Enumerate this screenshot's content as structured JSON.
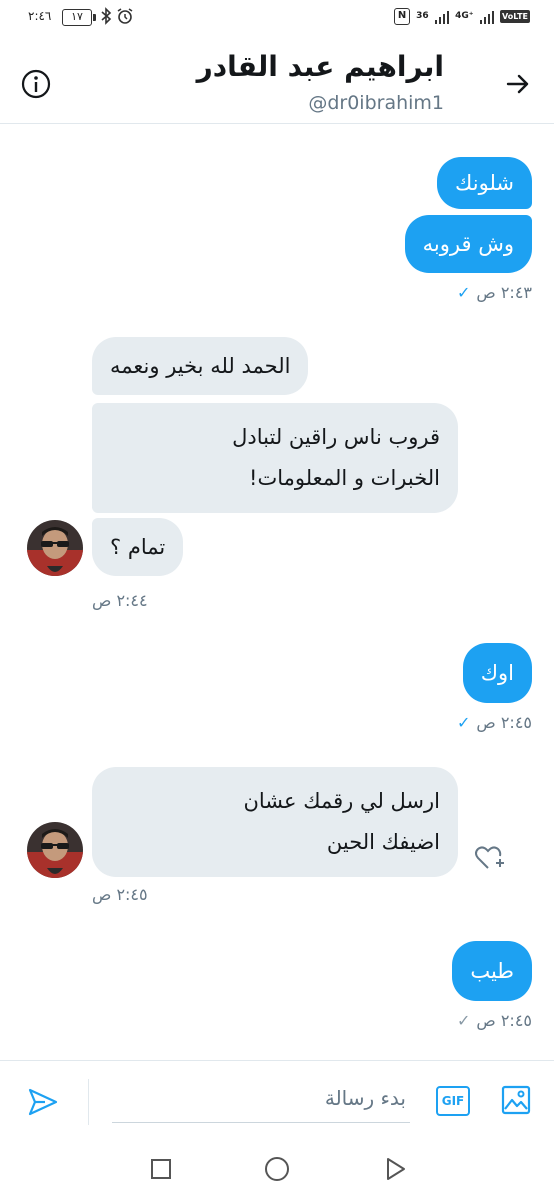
{
  "status_bar": {
    "time": "٢:٤٦",
    "battery": "١٧",
    "icons": [
      "battery-icon",
      "bluetooth-icon",
      "alarm-icon",
      "nfc-icon",
      "signal-icon",
      "wifi-icon",
      "volte-icon"
    ],
    "network_top": "4G⁺",
    "network_label": "36",
    "volte": "VoLTE"
  },
  "header": {
    "name": "ابراهيم عبد القادر",
    "handle": "@dr0ibrahim1",
    "info_icon": "info-icon",
    "back_icon": "arrow-right-icon"
  },
  "messages": [
    {
      "direction": "out",
      "text": "شلونك"
    },
    {
      "direction": "out",
      "text": "وش قروبه"
    },
    {
      "direction": "out",
      "meta_time": "٢:٤٣ ص",
      "status": "sent"
    },
    {
      "direction": "in",
      "text": "الحمد لله بخير ونعمه"
    },
    {
      "direction": "in",
      "lines": [
        "قروب ناس راقين لتبادل",
        "الخبرات و المعلومات!"
      ]
    },
    {
      "direction": "in",
      "text": "تمام ؟"
    },
    {
      "direction": "in",
      "meta_time": "٢:٤٤ ص"
    },
    {
      "direction": "out",
      "text": "اوك"
    },
    {
      "direction": "out",
      "meta_time": "٢:٤٥ ص",
      "status": "sent"
    },
    {
      "direction": "in",
      "lines": [
        "ارسل لي رقمك عشان",
        "اضيفك الحين"
      ]
    },
    {
      "direction": "in",
      "meta_time": "٢:٤٥ ص"
    },
    {
      "direction": "out",
      "text": "طيب"
    },
    {
      "direction": "out",
      "meta_time": "٢:٤٥ ص",
      "status": "pending"
    }
  ],
  "composer": {
    "placeholder": "بدء رسالة",
    "gif_label": "GIF",
    "send_icon": "send-icon",
    "image_icon": "image-icon"
  },
  "navbar": {
    "icons": [
      "recent-apps-icon",
      "home-icon",
      "back-triangle-icon"
    ]
  },
  "colors": {
    "accent": "#1da1f2",
    "incoming_bubble": "#e6ecf0",
    "secondary_text": "#657786"
  }
}
